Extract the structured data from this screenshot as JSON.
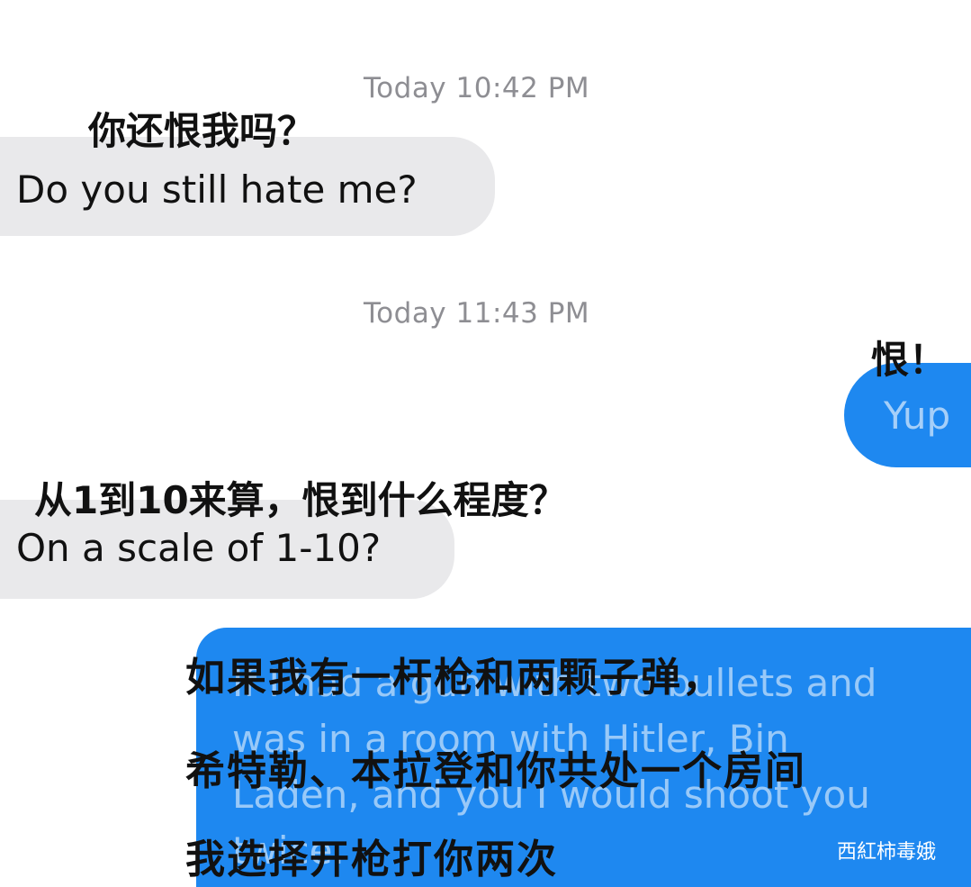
{
  "thread": {
    "timestamp_1": "Today 10:42 PM",
    "timestamp_2": "Today 11:43 PM"
  },
  "messages": [
    {
      "side": "received",
      "english": "Do you still hate me?",
      "chinese_caption": "你还恨我吗？"
    },
    {
      "side": "sent",
      "english": "Yup",
      "chinese_caption": "恨！"
    },
    {
      "side": "received",
      "english": "On a scale of 1-10?",
      "chinese_caption": "从1到10来算，恨到什么程度？"
    },
    {
      "side": "sent",
      "english_lines": [
        "If I had a gun with two bullets and",
        "was in a room with Hitler, Bin",
        "Laden, and you I would shoot you",
        "twice."
      ],
      "chinese_caption_lines": [
        "如果我有一杆枪和两颗子弹，",
        "希特勒、本拉登和你共处一个房间",
        "我选择开枪打你两次"
      ]
    }
  ],
  "colors": {
    "received_bubble": "#e9e9eb",
    "sent_bubble": "#1e88f0",
    "timestamp_text": "#8e8e93"
  },
  "watermark": "西紅柿毒娥"
}
